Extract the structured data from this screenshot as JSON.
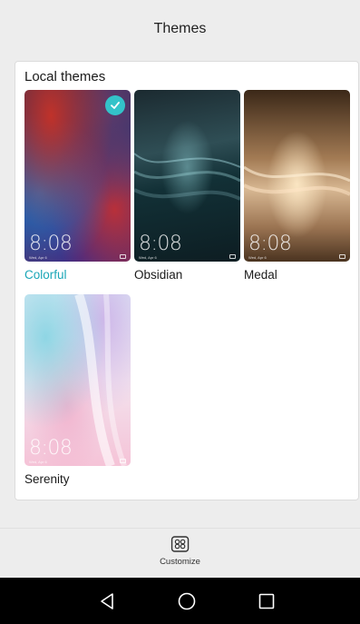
{
  "header": {
    "title": "Themes"
  },
  "local_themes": {
    "label": "Local themes",
    "items": [
      {
        "name": "Colorful",
        "clock": "8:08",
        "date": "Wed, Apr 6",
        "selected": true
      },
      {
        "name": "Obsidian",
        "clock": "8:08",
        "date": "Wed, Apr 6",
        "selected": false
      },
      {
        "name": "Medal",
        "clock": "8:08",
        "date": "Wed, Apr 6",
        "selected": false
      },
      {
        "name": "Serenity",
        "clock": "8:08",
        "date": "Wed, Apr 6",
        "selected": false
      }
    ]
  },
  "bottom_bar": {
    "customize_label": "Customize",
    "customize_icon": "customize-grid-icon"
  },
  "nav": {
    "back_icon": "back-triangle-icon",
    "home_icon": "home-circle-icon",
    "recents_icon": "recents-square-icon"
  },
  "colors": {
    "accent": "#1aa6b7",
    "check": "#33c3c9"
  }
}
